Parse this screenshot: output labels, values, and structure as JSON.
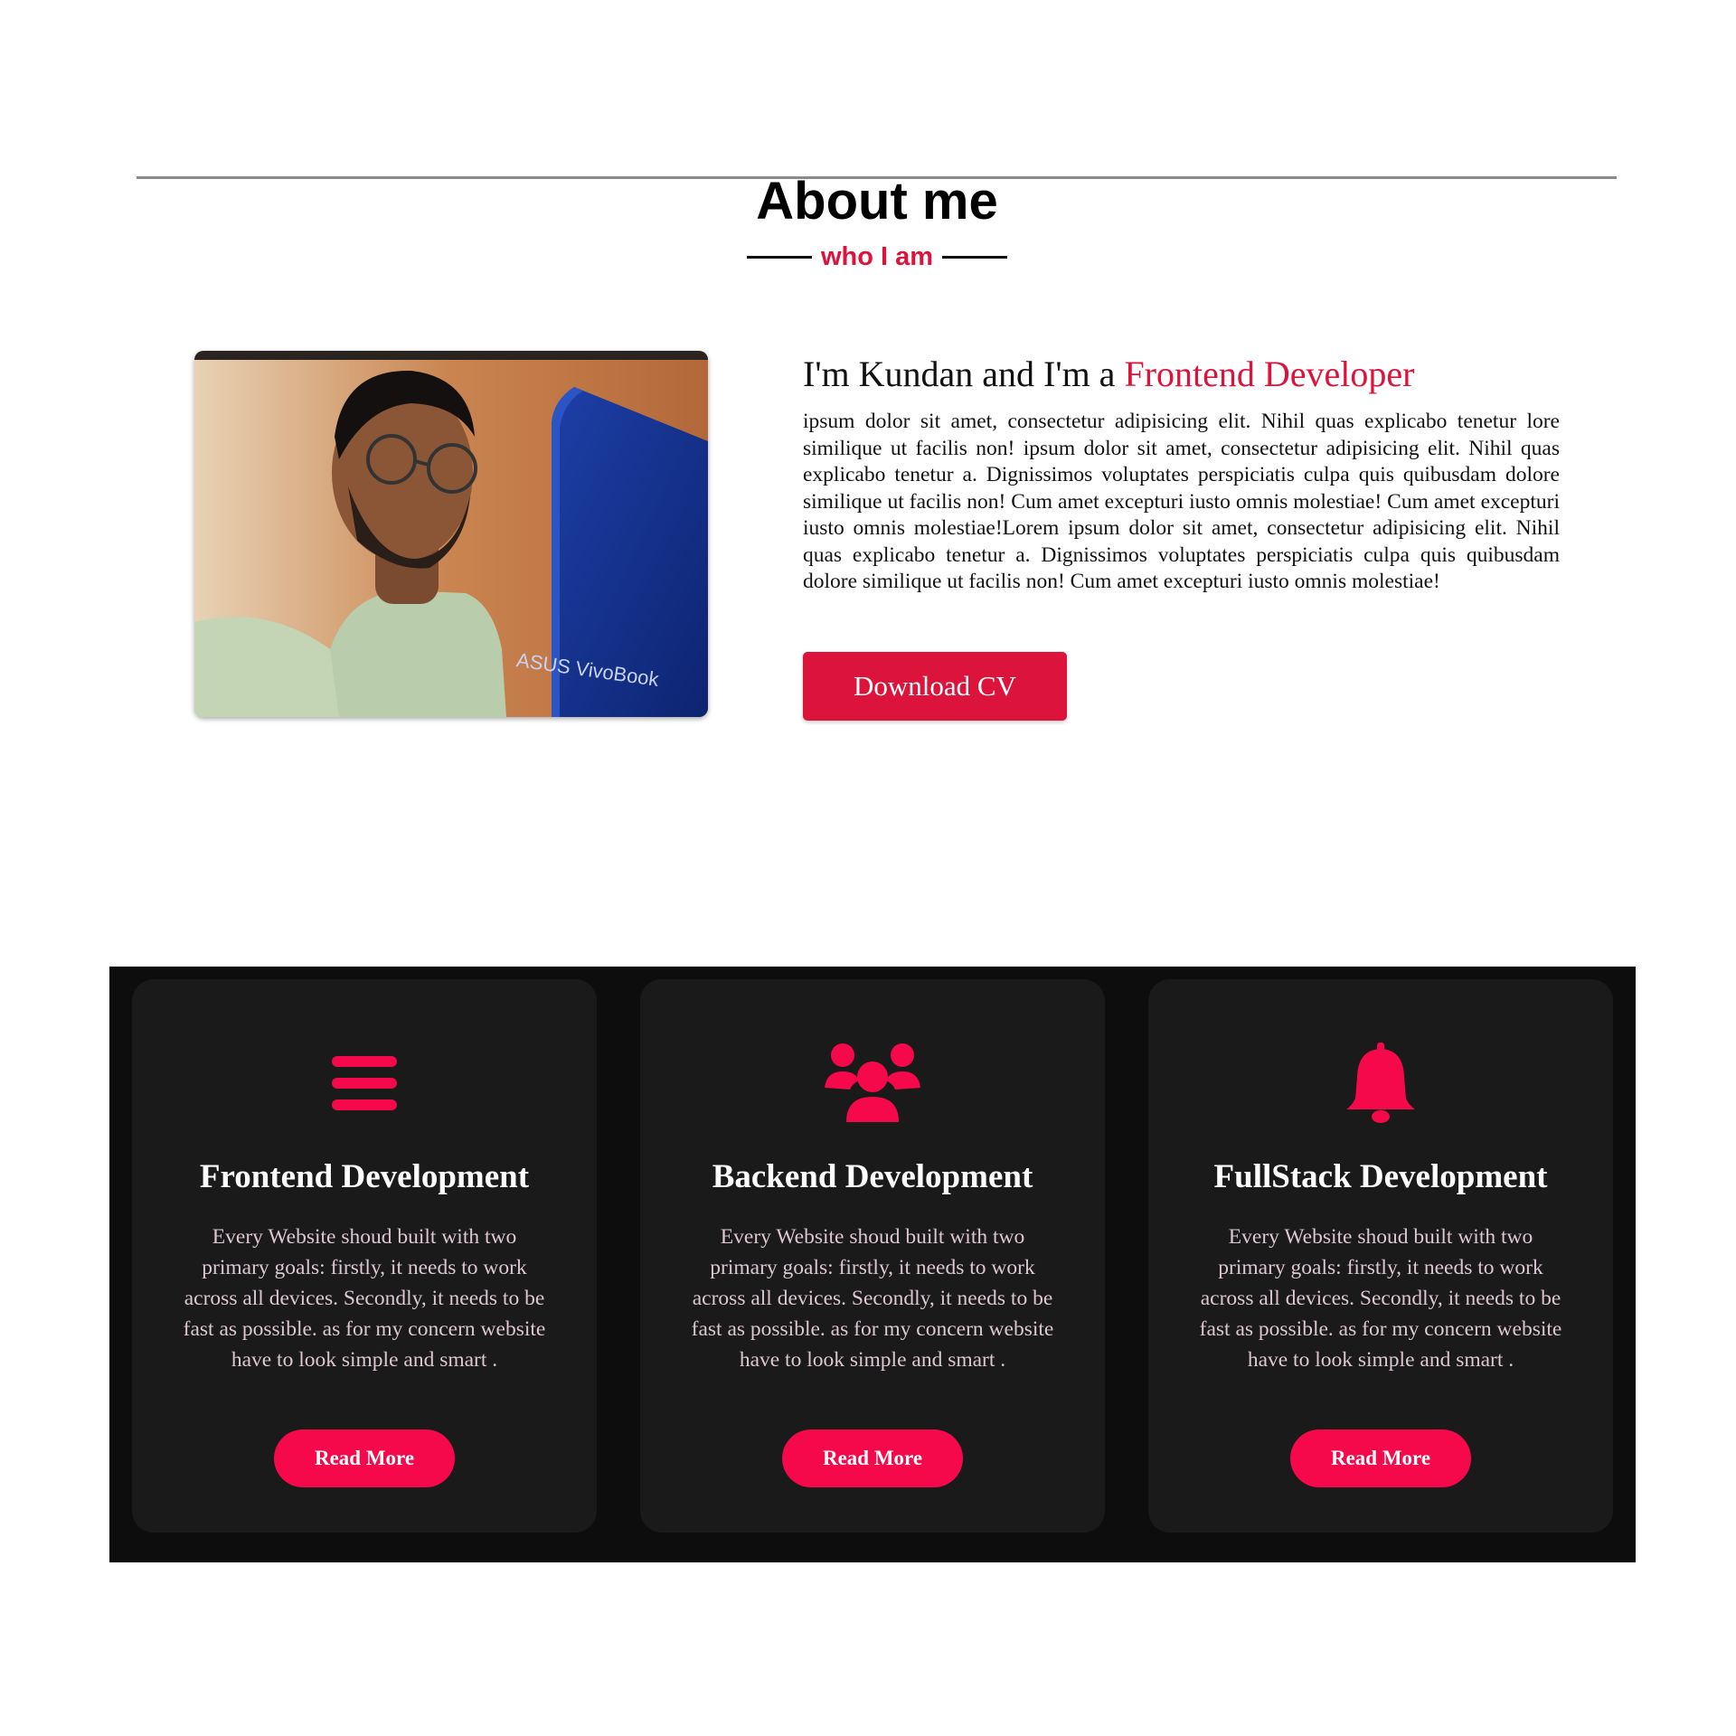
{
  "about": {
    "title": "About me",
    "subtitle": "who I am",
    "photo_icon": "profile-photo",
    "laptop_brand": "ASUS VivoBook",
    "heading_prefix": "I'm Kundan and I'm a ",
    "heading_role": "Frontend Developer",
    "body": "ipsum dolor sit amet, consectetur adipisicing elit. Nihil quas explicabo tenetur lore similique ut facilis non! ipsum dolor sit amet, consectetur adipisicing elit. Nihil quas explicabo tenetur a. Dignissimos voluptates perspiciatis culpa quis quibusdam dolore similique ut facilis non! Cum amet excepturi iusto omnis molestiae! Cum amet excepturi iusto omnis molestiae!Lorem ipsum dolor sit amet, consectetur adipisicing elit. Nihil quas explicabo tenetur a. Dignissimos voluptates perspiciatis culpa quis quibusdam dolore similique ut facilis non! Cum amet excepturi iusto omnis molestiae!",
    "download_label": "Download CV"
  },
  "services": [
    {
      "icon": "bars-icon",
      "title": "Frontend Development",
      "description": "Every Website shoud built with two primary goals: firstly, it needs to work across all devices. Secondly, it needs to be fast as possible. as for my concern website have to look simple and smart .",
      "button_label": "Read More"
    },
    {
      "icon": "users-icon",
      "title": "Backend Development",
      "description": "Every Website shoud built with two primary goals: firstly, it needs to work across all devices. Secondly, it needs to be fast as possible. as for my concern website have to look simple and smart .",
      "button_label": "Read More"
    },
    {
      "icon": "bell-icon",
      "title": "FullStack Development",
      "description": "Every Website shoud built with two primary goals: firstly, it needs to work across all devices. Secondly, it needs to be fast as possible. as for my concern website have to look simple and smart .",
      "button_label": "Read More"
    }
  ],
  "colors": {
    "accent": "#dc143c",
    "button_pink": "#f5094a",
    "dark_bg": "#0d0d0d",
    "card_bg": "#1a1a1a"
  }
}
